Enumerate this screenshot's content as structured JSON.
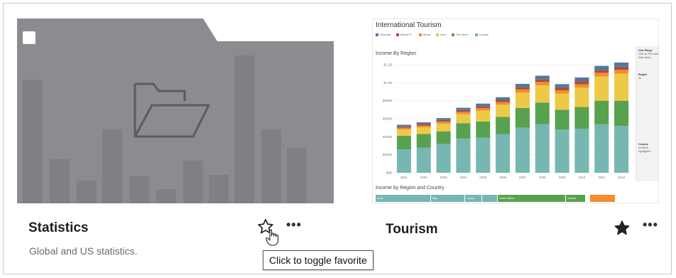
{
  "cards": [
    {
      "title": "Statistics",
      "description": "Global and US statistics.",
      "favorited": false,
      "type": "project-folder",
      "icons": {
        "folder": "folder-open-icon",
        "favorite": "star-outline-icon",
        "more": "more-options-icon",
        "cursor": "hand-pointer-cursor-icon"
      },
      "more_label": "•••"
    },
    {
      "title": "Tourism",
      "favorited": true,
      "type": "workbook",
      "icons": {
        "favorite": "star-filled-icon",
        "more": "more-options-icon"
      },
      "more_label": "•••",
      "thumbnail": {
        "title": "International Tourism",
        "legend": [
          {
            "label": "Oceania",
            "color": "#4e79a7"
          },
          {
            "label": "Middle E..",
            "color": "#a84f3d"
          },
          {
            "label": "Africa",
            "color": "#f28e2b"
          },
          {
            "label": "Asia",
            "color": "#edc948"
          },
          {
            "label": "The Amer..",
            "color": "#59a14f"
          },
          {
            "label": "Europe",
            "color": "#76b7b2"
          }
        ],
        "chart_subtitle": "Income By Region",
        "table_subtitle": "Income by Region and Country",
        "side_panel": {
          "year_range_label": "Year Range",
          "year_range_value": "2001 to 2012 and Null values",
          "region_label": "Region",
          "region_value": "All",
          "country_label": "Country",
          "country_value": "No items highlighted"
        },
        "countries": [
          "Spain",
          "Italy",
          "Turkey",
          "",
          "United States",
          "Canada",
          "",
          ""
        ]
      }
    }
  ],
  "tooltip": "Click to toggle favorite",
  "chart_data": {
    "type": "bar",
    "title": "International Tourism",
    "subtitle": "Income By Region",
    "categories": [
      "2001",
      "2002",
      "2003",
      "2004",
      "2005",
      "2006",
      "2007",
      "2008",
      "2009",
      "2010",
      "2011",
      "2012"
    ],
    "y_ticks": [
      "$0B",
      "$200B",
      "$400B",
      "$600B",
      "$800B",
      "$1.0B",
      "$1.2B"
    ],
    "ylim": [
      0,
      1200
    ],
    "stacked": true,
    "series": [
      {
        "name": "Europe",
        "color": "#76b7b2",
        "values": [
          260,
          280,
          320,
          380,
          390,
          430,
          500,
          540,
          480,
          490,
          540,
          520
        ]
      },
      {
        "name": "The Amer..",
        "color": "#59a14f",
        "values": [
          150,
          150,
          140,
          170,
          180,
          190,
          220,
          240,
          220,
          240,
          260,
          280
        ]
      },
      {
        "name": "Asia",
        "color": "#edc948",
        "values": [
          70,
          75,
          85,
          100,
          120,
          135,
          170,
          190,
          180,
          215,
          270,
          300
        ]
      },
      {
        "name": "Africa",
        "color": "#f28e2b",
        "values": [
          20,
          20,
          22,
          26,
          28,
          30,
          35,
          38,
          36,
          38,
          40,
          42
        ]
      },
      {
        "name": "Middle E..",
        "color": "#a84f3d",
        "values": [
          15,
          16,
          18,
          20,
          22,
          24,
          28,
          32,
          32,
          35,
          33,
          36
        ]
      },
      {
        "name": "Oceania",
        "color": "#4e79a7",
        "values": [
          18,
          19,
          22,
          26,
          28,
          30,
          34,
          38,
          36,
          40,
          44,
          46
        ]
      }
    ]
  }
}
